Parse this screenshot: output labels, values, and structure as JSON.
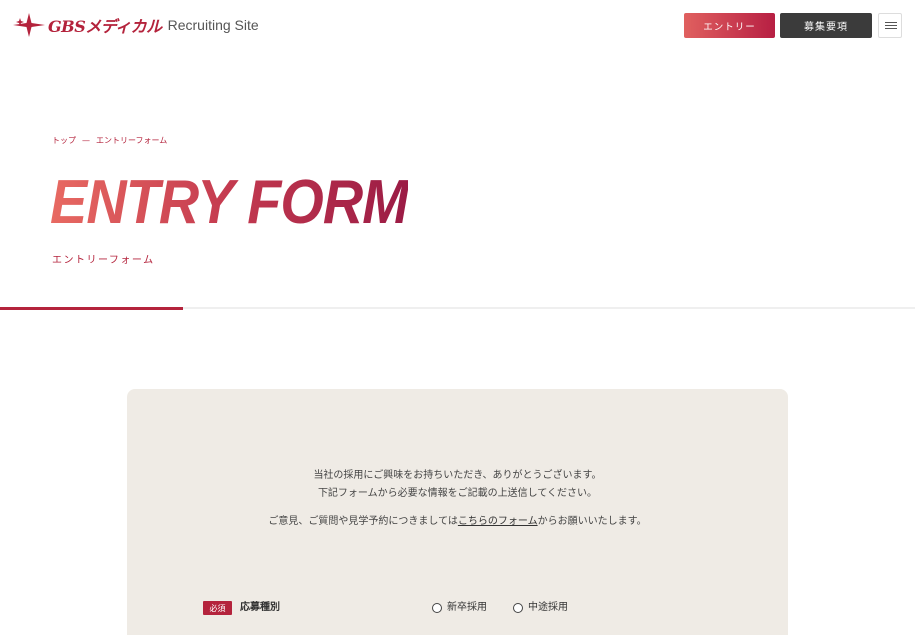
{
  "header": {
    "logo_brand": "GBSメディカル",
    "logo_sub": "Recruiting Site",
    "entry_button": "エントリー",
    "recruit_button": "募集要項"
  },
  "breadcrumb": {
    "home": "トップ",
    "separator": "—",
    "current": "エントリーフォーム"
  },
  "hero": {
    "title": "ENTRY FORM",
    "subtitle": "エントリーフォーム",
    "progress_fraction": 0.2
  },
  "intro": {
    "line1": "当社の採用にご興味をお持ちいただき、ありがとうございます。",
    "line2": "下記フォームから必要な情報をご記載の上送信してください。",
    "line3_before": "ご意見、ご質問や見学予約につきましては",
    "line3_link": "こちらのフォーム",
    "line3_after": "からお願いいたします。"
  },
  "form": {
    "required_badge": "必須",
    "field_label": "応募種別",
    "options": [
      "新卒採用",
      "中途採用"
    ]
  },
  "colors": {
    "accent": "#b4233c",
    "card_bg": "#efebe5",
    "dark_button": "#3b3b3b"
  }
}
